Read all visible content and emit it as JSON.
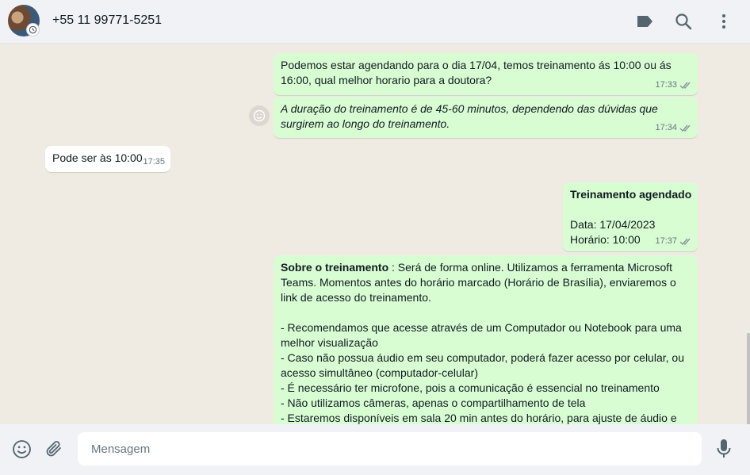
{
  "header": {
    "contact": "+55 11 99771-5251",
    "icons": [
      "label-icon",
      "search-icon",
      "menu-icon"
    ]
  },
  "messages": [
    {
      "direction": "out",
      "lines": [
        "Podemos estar agendando para o dia 17/04, temos treinamento ás 10:00 ou ás",
        "16:00, qual melhor horario para a doutora?"
      ],
      "time": "17:33"
    },
    {
      "direction": "out",
      "lines": [
        "A duração do treinamento é de 45-60 minutos, dependendo das dúvidas que",
        "surgirem ao longo do treinamento."
      ],
      "time": "17:34"
    },
    {
      "direction": "in",
      "lines": [
        "Pode ser às 10:00"
      ],
      "time": "17:35"
    },
    {
      "direction": "out",
      "title": "Treinamento agendado",
      "lines": [
        "",
        "Data: 17/04/2023",
        "Horário: 10:00"
      ],
      "time": "17:37"
    },
    {
      "direction": "out",
      "title": "Sobre o treinamento",
      "lines": [
        " : Será de forma online. Utilizamos a ferramenta Microsoft",
        "Teams. Momentos antes do horário marcado (Horário de Brasília), enviaremos o",
        "link de acesso do treinamento.",
        "",
        "- Recomendamos que acesse através de um Computador ou Notebook para uma",
        "melhor visualização",
        "- Caso não possua áudio em seu computador, poderá fazer acesso por celular, ou",
        "acesso simultâneo (computador-celular)",
        "- É necessário ter microfone, pois a comunicação é essencial no treinamento",
        "- Não utilizamos câmeras, apenas o compartilhamento de tela",
        "- Estaremos disponíveis em sala 20 min antes do horário, para ajuste de áudio e"
      ]
    }
  ],
  "footer": {
    "placeholder": "Mensagem"
  },
  "colors": {
    "outgoing_bubble": "#d9fdd3",
    "incoming_bubble": "#ffffff",
    "chat_background": "#efeae2",
    "read_ticks": "#8696a0"
  }
}
